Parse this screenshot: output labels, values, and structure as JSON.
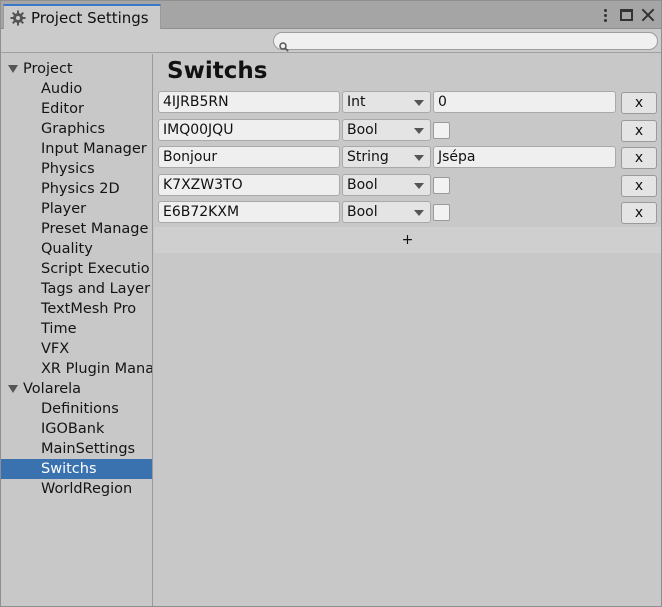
{
  "window": {
    "tab_title": "Project Settings"
  },
  "search": {
    "placeholder": "",
    "value": ""
  },
  "sidebar": {
    "groups": [
      {
        "label": "Project",
        "items": [
          "Audio",
          "Editor",
          "Graphics",
          "Input Manager",
          "Physics",
          "Physics 2D",
          "Player",
          "Preset Manage",
          "Quality",
          "Script Executio",
          "Tags and Layer",
          "TextMesh Pro",
          "Time",
          "VFX",
          "XR Plugin Mana"
        ]
      },
      {
        "label": "Volarela",
        "items": [
          "Definitions",
          "IGOBank",
          "MainSettings",
          "Switchs",
          "WorldRegion"
        ]
      }
    ],
    "selected": "Switchs"
  },
  "main": {
    "title": "Switchs",
    "remove_label": "x",
    "add_label": "+",
    "rows": [
      {
        "name": "4IJRB5RN",
        "type": "Int",
        "value": "0",
        "checked": null
      },
      {
        "name": "IMQ00JQU",
        "type": "Bool",
        "value": null,
        "checked": false
      },
      {
        "name": "Bonjour",
        "type": "String",
        "value": "Jsépa",
        "checked": null
      },
      {
        "name": "K7XZW3TO",
        "type": "Bool",
        "value": null,
        "checked": false
      },
      {
        "name": "E6B72KXM",
        "type": "Bool",
        "value": null,
        "checked": false
      }
    ]
  },
  "icons": {
    "tab": "gear-icon",
    "search": "search-icon",
    "menu": "kebab-menu-icon",
    "maximize": "maximize-icon",
    "close": "close-icon",
    "fold": "fold-arrow-icon",
    "dropdown": "chevron-down-icon"
  },
  "colors": {
    "selection": "#3a72b0",
    "tab_accent": "#3a79c7",
    "background": "#c8c8c8"
  }
}
